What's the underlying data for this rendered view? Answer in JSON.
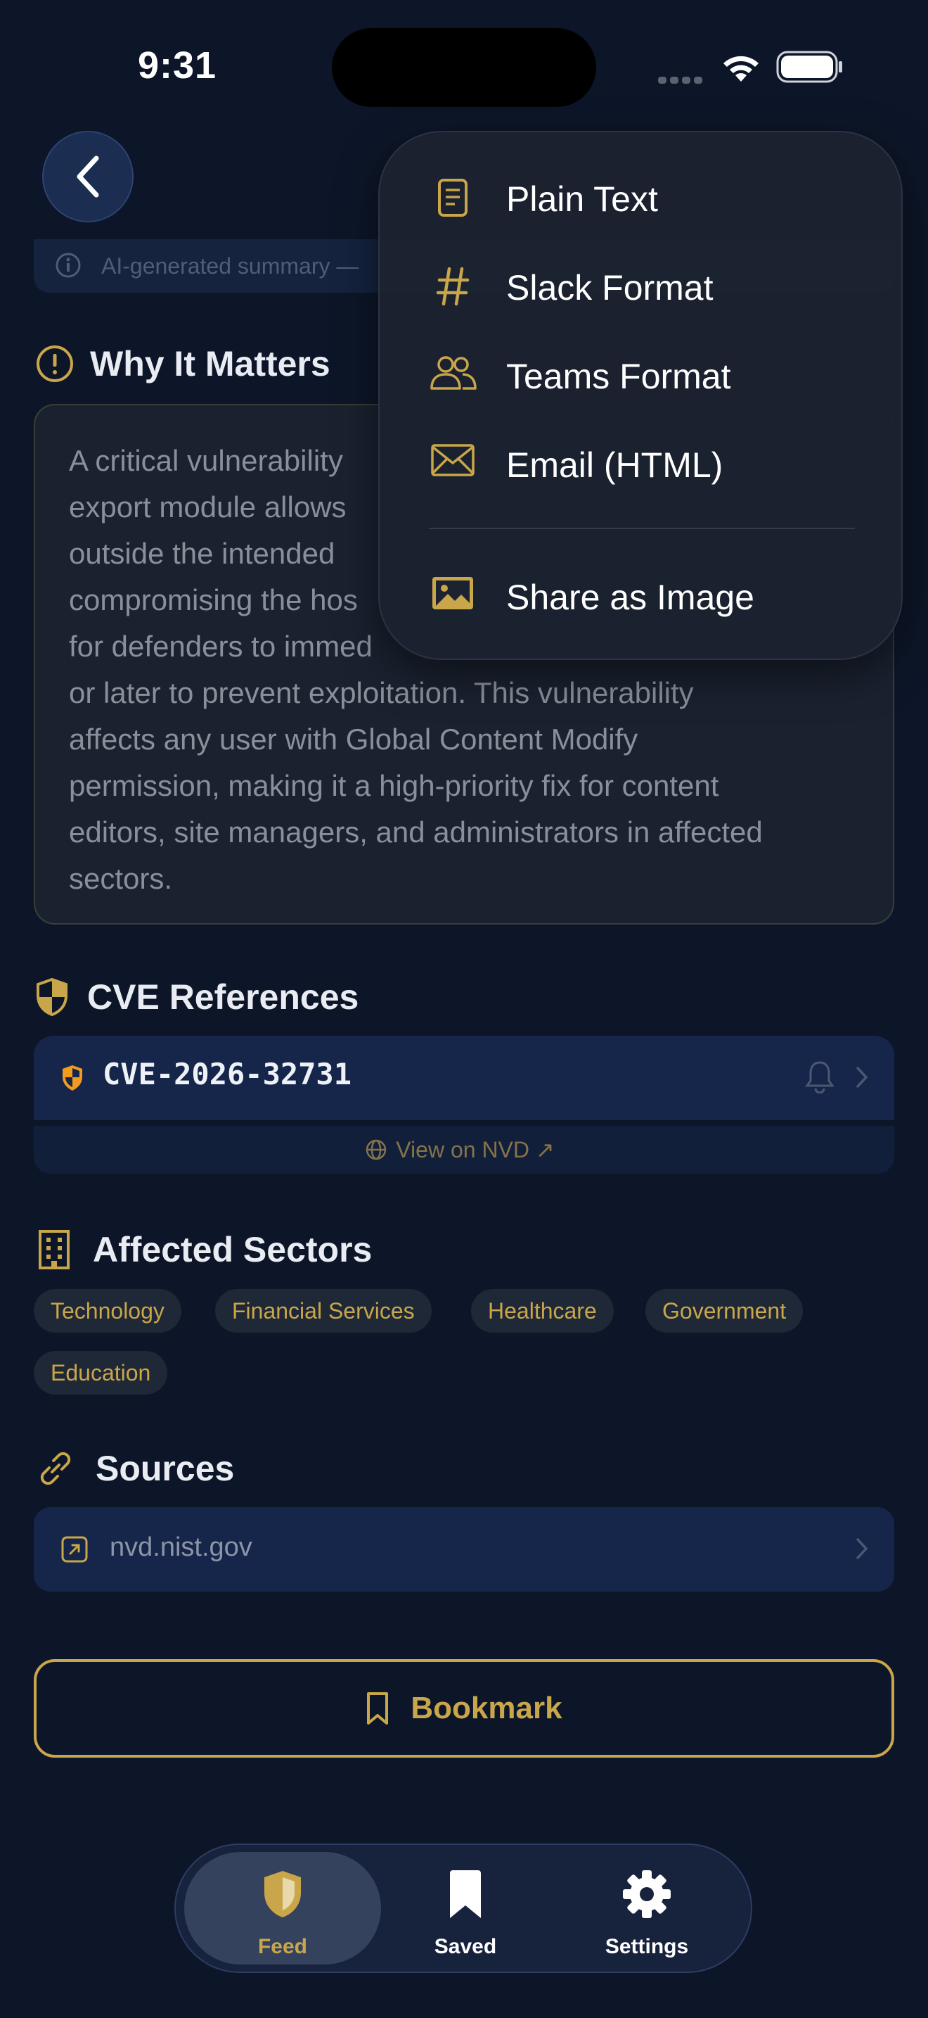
{
  "status_bar": {
    "time": "9:31"
  },
  "ai_summary": {
    "text": "AI-generated summary —"
  },
  "why_it_matters": {
    "title": "Why It Matters",
    "lines": [
      "A critical vulnerability",
      "export module allows",
      "outside the intended",
      "compromising the hos",
      "for defenders to immed",
      "or later to prevent exploitation. This vulnerability",
      "affects any user with Global Content Modify",
      "permission, making it a high-priority fix for content",
      "editors, site managers, and administrators in affected",
      "sectors."
    ]
  },
  "cve_references": {
    "title": "CVE References",
    "items": [
      {
        "id": "CVE-2026-32731"
      }
    ],
    "nvd_link": "View on NVD ↗"
  },
  "affected_sectors": {
    "title": "Affected Sectors",
    "chips": [
      "Technology",
      "Financial Services",
      "Healthcare",
      "Government",
      "Education"
    ]
  },
  "sources": {
    "title": "Sources",
    "items": [
      {
        "domain": "nvd.nist.gov"
      }
    ]
  },
  "bookmark_button": {
    "label": "Bookmark"
  },
  "tabbar": {
    "tabs": [
      {
        "label": "Feed",
        "icon": "shield-icon",
        "active": true
      },
      {
        "label": "Saved",
        "icon": "bookmark-icon",
        "active": false
      },
      {
        "label": "Settings",
        "icon": "gear-icon",
        "active": false
      }
    ]
  },
  "share_menu": {
    "items": [
      {
        "label": "Plain Text",
        "icon": "document-icon"
      },
      {
        "label": "Slack Format",
        "icon": "hash-icon"
      },
      {
        "label": "Teams Format",
        "icon": "people-icon"
      },
      {
        "label": "Email (HTML)",
        "icon": "envelope-icon"
      },
      {
        "label": "Share as Image",
        "icon": "image-icon"
      }
    ]
  },
  "colors": {
    "background": "#0d1628",
    "accent_gold": "#c9a64a",
    "card_navy": "#16264a",
    "severity_orange": "#f39b1f"
  }
}
